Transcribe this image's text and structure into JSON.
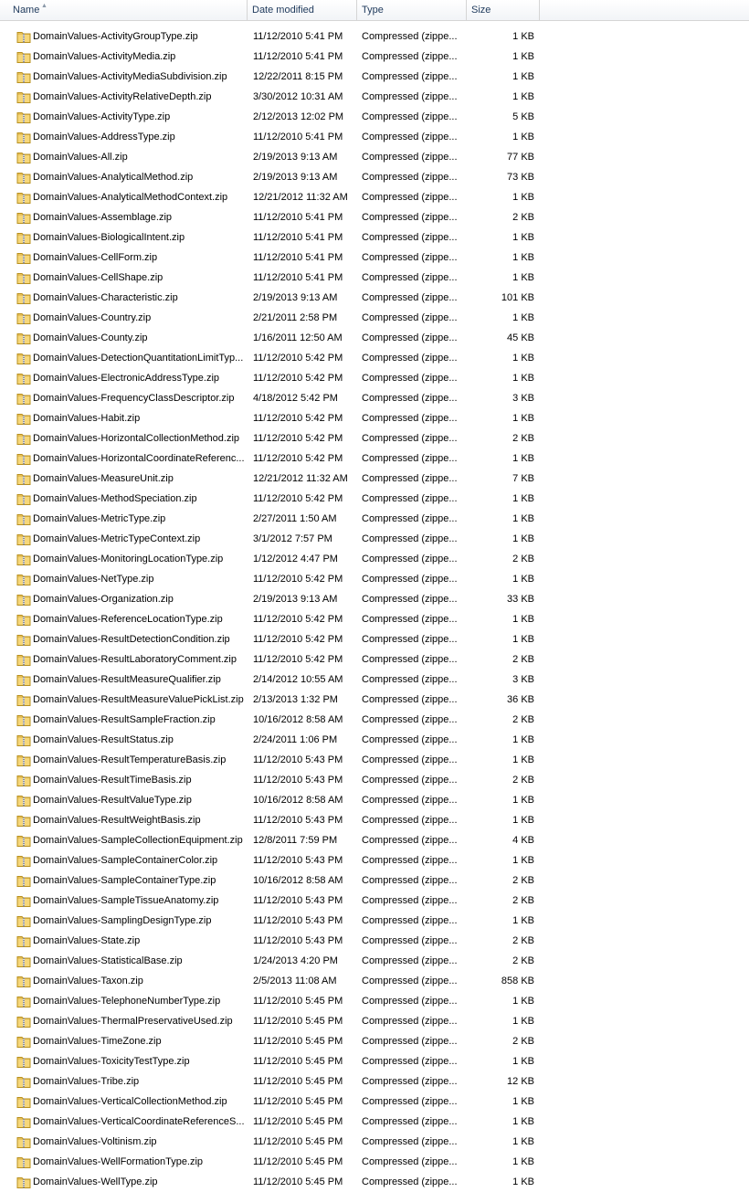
{
  "columns": {
    "name": "Name",
    "date": "Date modified",
    "type": "Type",
    "size": "Size"
  },
  "sort": {
    "column": "name",
    "direction": "ascending",
    "icon": "sort-up-arrow-icon"
  },
  "file_icon": "zip-folder-icon",
  "files": [
    {
      "name": "DomainValues-ActivityGroupType.zip",
      "date": "11/12/2010 5:41 PM",
      "type": "Compressed (zippe...",
      "size": "1 KB"
    },
    {
      "name": "DomainValues-ActivityMedia.zip",
      "date": "11/12/2010 5:41 PM",
      "type": "Compressed (zippe...",
      "size": "1 KB"
    },
    {
      "name": "DomainValues-ActivityMediaSubdivision.zip",
      "date": "12/22/2011 8:15 PM",
      "type": "Compressed (zippe...",
      "size": "1 KB"
    },
    {
      "name": "DomainValues-ActivityRelativeDepth.zip",
      "date": "3/30/2012 10:31 AM",
      "type": "Compressed (zippe...",
      "size": "1 KB"
    },
    {
      "name": "DomainValues-ActivityType.zip",
      "date": "2/12/2013 12:02 PM",
      "type": "Compressed (zippe...",
      "size": "5 KB"
    },
    {
      "name": "DomainValues-AddressType.zip",
      "date": "11/12/2010 5:41 PM",
      "type": "Compressed (zippe...",
      "size": "1 KB"
    },
    {
      "name": "DomainValues-All.zip",
      "date": "2/19/2013 9:13 AM",
      "type": "Compressed (zippe...",
      "size": "77 KB"
    },
    {
      "name": "DomainValues-AnalyticalMethod.zip",
      "date": "2/19/2013 9:13 AM",
      "type": "Compressed (zippe...",
      "size": "73 KB"
    },
    {
      "name": "DomainValues-AnalyticalMethodContext.zip",
      "date": "12/21/2012 11:32 AM",
      "type": "Compressed (zippe...",
      "size": "1 KB"
    },
    {
      "name": "DomainValues-Assemblage.zip",
      "date": "11/12/2010 5:41 PM",
      "type": "Compressed (zippe...",
      "size": "2 KB"
    },
    {
      "name": "DomainValues-BiologicalIntent.zip",
      "date": "11/12/2010 5:41 PM",
      "type": "Compressed (zippe...",
      "size": "1 KB"
    },
    {
      "name": "DomainValues-CellForm.zip",
      "date": "11/12/2010 5:41 PM",
      "type": "Compressed (zippe...",
      "size": "1 KB"
    },
    {
      "name": "DomainValues-CellShape.zip",
      "date": "11/12/2010 5:41 PM",
      "type": "Compressed (zippe...",
      "size": "1 KB"
    },
    {
      "name": "DomainValues-Characteristic.zip",
      "date": "2/19/2013 9:13 AM",
      "type": "Compressed (zippe...",
      "size": "101 KB"
    },
    {
      "name": "DomainValues-Country.zip",
      "date": "2/21/2011 2:58 PM",
      "type": "Compressed (zippe...",
      "size": "1 KB"
    },
    {
      "name": "DomainValues-County.zip",
      "date": "1/16/2011 12:50 AM",
      "type": "Compressed (zippe...",
      "size": "45 KB"
    },
    {
      "name": "DomainValues-DetectionQuantitationLimitTyp...",
      "date": "11/12/2010 5:42 PM",
      "type": "Compressed (zippe...",
      "size": "1 KB"
    },
    {
      "name": "DomainValues-ElectronicAddressType.zip",
      "date": "11/12/2010 5:42 PM",
      "type": "Compressed (zippe...",
      "size": "1 KB"
    },
    {
      "name": "DomainValues-FrequencyClassDescriptor.zip",
      "date": "4/18/2012 5:42 PM",
      "type": "Compressed (zippe...",
      "size": "3 KB"
    },
    {
      "name": "DomainValues-Habit.zip",
      "date": "11/12/2010 5:42 PM",
      "type": "Compressed (zippe...",
      "size": "1 KB"
    },
    {
      "name": "DomainValues-HorizontalCollectionMethod.zip",
      "date": "11/12/2010 5:42 PM",
      "type": "Compressed (zippe...",
      "size": "2 KB"
    },
    {
      "name": "DomainValues-HorizontalCoordinateReferenc...",
      "date": "11/12/2010 5:42 PM",
      "type": "Compressed (zippe...",
      "size": "1 KB"
    },
    {
      "name": "DomainValues-MeasureUnit.zip",
      "date": "12/21/2012 11:32 AM",
      "type": "Compressed (zippe...",
      "size": "7 KB"
    },
    {
      "name": "DomainValues-MethodSpeciation.zip",
      "date": "11/12/2010 5:42 PM",
      "type": "Compressed (zippe...",
      "size": "1 KB"
    },
    {
      "name": "DomainValues-MetricType.zip",
      "date": "2/27/2011 1:50 AM",
      "type": "Compressed (zippe...",
      "size": "1 KB"
    },
    {
      "name": "DomainValues-MetricTypeContext.zip",
      "date": "3/1/2012 7:57 PM",
      "type": "Compressed (zippe...",
      "size": "1 KB"
    },
    {
      "name": "DomainValues-MonitoringLocationType.zip",
      "date": "1/12/2012 4:47 PM",
      "type": "Compressed (zippe...",
      "size": "2 KB"
    },
    {
      "name": "DomainValues-NetType.zip",
      "date": "11/12/2010 5:42 PM",
      "type": "Compressed (zippe...",
      "size": "1 KB"
    },
    {
      "name": "DomainValues-Organization.zip",
      "date": "2/19/2013 9:13 AM",
      "type": "Compressed (zippe...",
      "size": "33 KB"
    },
    {
      "name": "DomainValues-ReferenceLocationType.zip",
      "date": "11/12/2010 5:42 PM",
      "type": "Compressed (zippe...",
      "size": "1 KB"
    },
    {
      "name": "DomainValues-ResultDetectionCondition.zip",
      "date": "11/12/2010 5:42 PM",
      "type": "Compressed (zippe...",
      "size": "1 KB"
    },
    {
      "name": "DomainValues-ResultLaboratoryComment.zip",
      "date": "11/12/2010 5:42 PM",
      "type": "Compressed (zippe...",
      "size": "2 KB"
    },
    {
      "name": "DomainValues-ResultMeasureQualifier.zip",
      "date": "2/14/2012 10:55 AM",
      "type": "Compressed (zippe...",
      "size": "3 KB"
    },
    {
      "name": "DomainValues-ResultMeasureValuePickList.zip",
      "date": "2/13/2013 1:32 PM",
      "type": "Compressed (zippe...",
      "size": "36 KB"
    },
    {
      "name": "DomainValues-ResultSampleFraction.zip",
      "date": "10/16/2012 8:58 AM",
      "type": "Compressed (zippe...",
      "size": "2 KB"
    },
    {
      "name": "DomainValues-ResultStatus.zip",
      "date": "2/24/2011 1:06 PM",
      "type": "Compressed (zippe...",
      "size": "1 KB"
    },
    {
      "name": "DomainValues-ResultTemperatureBasis.zip",
      "date": "11/12/2010 5:43 PM",
      "type": "Compressed (zippe...",
      "size": "1 KB"
    },
    {
      "name": "DomainValues-ResultTimeBasis.zip",
      "date": "11/12/2010 5:43 PM",
      "type": "Compressed (zippe...",
      "size": "2 KB"
    },
    {
      "name": "DomainValues-ResultValueType.zip",
      "date": "10/16/2012 8:58 AM",
      "type": "Compressed (zippe...",
      "size": "1 KB"
    },
    {
      "name": "DomainValues-ResultWeightBasis.zip",
      "date": "11/12/2010 5:43 PM",
      "type": "Compressed (zippe...",
      "size": "1 KB"
    },
    {
      "name": "DomainValues-SampleCollectionEquipment.zip",
      "date": "12/8/2011 7:59 PM",
      "type": "Compressed (zippe...",
      "size": "4 KB"
    },
    {
      "name": "DomainValues-SampleContainerColor.zip",
      "date": "11/12/2010 5:43 PM",
      "type": "Compressed (zippe...",
      "size": "1 KB"
    },
    {
      "name": "DomainValues-SampleContainerType.zip",
      "date": "10/16/2012 8:58 AM",
      "type": "Compressed (zippe...",
      "size": "2 KB"
    },
    {
      "name": "DomainValues-SampleTissueAnatomy.zip",
      "date": "11/12/2010 5:43 PM",
      "type": "Compressed (zippe...",
      "size": "2 KB"
    },
    {
      "name": "DomainValues-SamplingDesignType.zip",
      "date": "11/12/2010 5:43 PM",
      "type": "Compressed (zippe...",
      "size": "1 KB"
    },
    {
      "name": "DomainValues-State.zip",
      "date": "11/12/2010 5:43 PM",
      "type": "Compressed (zippe...",
      "size": "2 KB"
    },
    {
      "name": "DomainValues-StatisticalBase.zip",
      "date": "1/24/2013 4:20 PM",
      "type": "Compressed (zippe...",
      "size": "2 KB"
    },
    {
      "name": "DomainValues-Taxon.zip",
      "date": "2/5/2013 11:08 AM",
      "type": "Compressed (zippe...",
      "size": "858 KB"
    },
    {
      "name": "DomainValues-TelephoneNumberType.zip",
      "date": "11/12/2010 5:45 PM",
      "type": "Compressed (zippe...",
      "size": "1 KB"
    },
    {
      "name": "DomainValues-ThermalPreservativeUsed.zip",
      "date": "11/12/2010 5:45 PM",
      "type": "Compressed (zippe...",
      "size": "1 KB"
    },
    {
      "name": "DomainValues-TimeZone.zip",
      "date": "11/12/2010 5:45 PM",
      "type": "Compressed (zippe...",
      "size": "2 KB"
    },
    {
      "name": "DomainValues-ToxicityTestType.zip",
      "date": "11/12/2010 5:45 PM",
      "type": "Compressed (zippe...",
      "size": "1 KB"
    },
    {
      "name": "DomainValues-Tribe.zip",
      "date": "11/12/2010 5:45 PM",
      "type": "Compressed (zippe...",
      "size": "12 KB"
    },
    {
      "name": "DomainValues-VerticalCollectionMethod.zip",
      "date": "11/12/2010 5:45 PM",
      "type": "Compressed (zippe...",
      "size": "1 KB"
    },
    {
      "name": "DomainValues-VerticalCoordinateReferenceS...",
      "date": "11/12/2010 5:45 PM",
      "type": "Compressed (zippe...",
      "size": "1 KB"
    },
    {
      "name": "DomainValues-Voltinism.zip",
      "date": "11/12/2010 5:45 PM",
      "type": "Compressed (zippe...",
      "size": "1 KB"
    },
    {
      "name": "DomainValues-WellFormationType.zip",
      "date": "11/12/2010 5:45 PM",
      "type": "Compressed (zippe...",
      "size": "1 KB"
    },
    {
      "name": "DomainValues-WellType.zip",
      "date": "11/12/2010 5:45 PM",
      "type": "Compressed (zippe...",
      "size": "1 KB"
    }
  ]
}
